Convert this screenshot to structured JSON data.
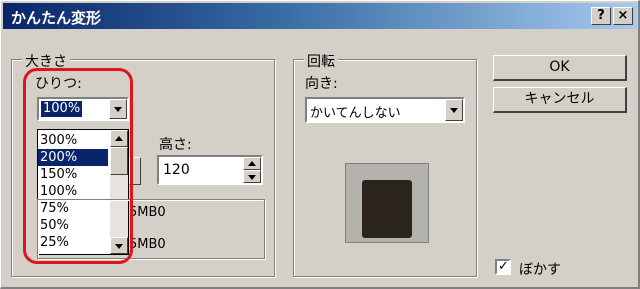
{
  "window": {
    "title": "かんたん変形",
    "help_label": "?",
    "close_label": "×"
  },
  "size_group": {
    "label": "大きさ",
    "ratio_label": "ひりつ:",
    "ratio_value": "100%",
    "height_label": "高さ:",
    "height_value": "120",
    "info_line1": "5MB0",
    "info_line2": "5MB0",
    "ratio_options": [
      "300%",
      "200%",
      "150%",
      "100%",
      "75%",
      "50%",
      "25%"
    ],
    "selected_option_index": 1
  },
  "rotate_group": {
    "label": "回転",
    "direction_label": "向き:",
    "direction_value": "かいてんしない"
  },
  "buttons": {
    "ok": "OK",
    "cancel": "キャンセル"
  },
  "blur": {
    "label": "ぼかす",
    "checked": true
  },
  "colors": {
    "highlight": "#e0141e",
    "selection": "#0a246a"
  }
}
